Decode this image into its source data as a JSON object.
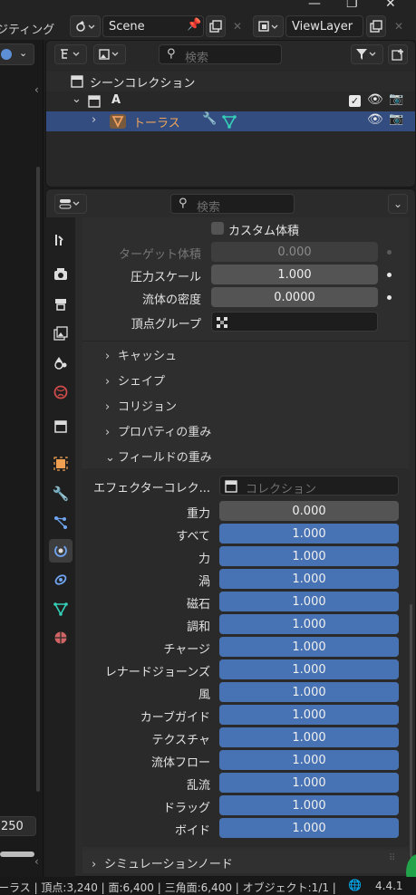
{
  "topbar": {
    "workspace_partial": "ジティング",
    "scene_label": "Scene",
    "viewlayer_label": "ViewLayer"
  },
  "outliner": {
    "search_placeholder": "検索",
    "scene_collection": "シーンコレクション",
    "collection_a": "A",
    "object_name": "トーラス"
  },
  "props": {
    "search_placeholder": "検索",
    "custom_volume": "カスタム体積",
    "rows_top": [
      {
        "label": "ターゲット体積",
        "value": "0.000",
        "dim": true
      },
      {
        "label": "圧力スケール",
        "value": "1.000",
        "dim": false
      },
      {
        "label": "流体の密度",
        "value": "0.0000",
        "dim": false
      }
    ],
    "vertex_group_label": "頂点グループ",
    "panels": [
      "キャッシュ",
      "シェイプ",
      "コリジョン",
      "プロパティの重み"
    ],
    "field_weights_title": "フィールドの重み",
    "effector_label": "エフェクターコレク...",
    "effector_placeholder": "コレクション",
    "weights": [
      {
        "label": "重力",
        "value": "0.000",
        "fill": 0.0
      },
      {
        "label": "すべて",
        "value": "1.000",
        "fill": 1.0
      },
      {
        "label": "力",
        "value": "1.000",
        "fill": 1.0
      },
      {
        "label": "渦",
        "value": "1.000",
        "fill": 1.0
      },
      {
        "label": "磁石",
        "value": "1.000",
        "fill": 1.0
      },
      {
        "label": "調和",
        "value": "1.000",
        "fill": 1.0
      },
      {
        "label": "チャージ",
        "value": "1.000",
        "fill": 1.0
      },
      {
        "label": "レナードジョーンズ",
        "value": "1.000",
        "fill": 1.0
      },
      {
        "label": "風",
        "value": "1.000",
        "fill": 1.0
      },
      {
        "label": "カーブガイド",
        "value": "1.000",
        "fill": 1.0
      },
      {
        "label": "テクスチャ",
        "value": "1.000",
        "fill": 1.0
      },
      {
        "label": "流体フロー",
        "value": "1.000",
        "fill": 1.0
      },
      {
        "label": "乱流",
        "value": "1.000",
        "fill": 1.0
      },
      {
        "label": "ドラッグ",
        "value": "1.000",
        "fill": 1.0
      },
      {
        "label": "ボイド",
        "value": "1.000",
        "fill": 1.0
      }
    ],
    "simulation_nodes": "シミュレーションノード"
  },
  "left_view": {
    "frame_value": "250"
  },
  "statusbar": {
    "text": "ーラス | 頂点:3,240 | 面:6,400 | 三角面:6,400 | オブジェクト:1/1 |",
    "version": "4.4.1"
  },
  "colors": {
    "accent_blue": "#4772b3",
    "object_orange": "#e8813b",
    "selected_row": "#334d80"
  }
}
